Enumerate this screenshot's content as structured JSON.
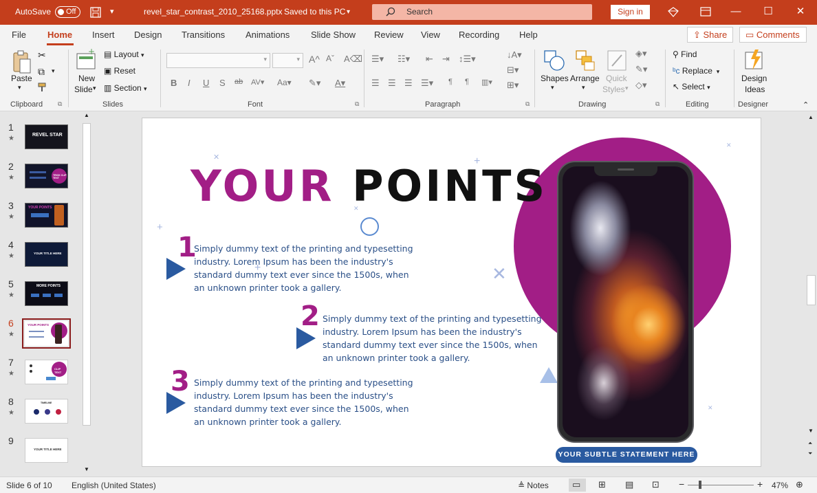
{
  "titlebar": {
    "autosave_label": "AutoSave",
    "autosave_state": "Off",
    "filename": "revel_star_contrast_2010_25168.pptx",
    "save_status": "Saved to this PC",
    "search_placeholder": "Search",
    "signin": "Sign in"
  },
  "tabs": [
    "File",
    "Home",
    "Insert",
    "Design",
    "Transitions",
    "Animations",
    "Slide Show",
    "Review",
    "View",
    "Recording",
    "Help"
  ],
  "share": "Share",
  "comments": "Comments",
  "ribbon": {
    "clipboard": {
      "paste": "Paste",
      "label": "Clipboard"
    },
    "slides": {
      "new_slide_1": "New",
      "new_slide_2": "Slide",
      "layout": "Layout",
      "reset": "Reset",
      "section": "Section",
      "label": "Slides"
    },
    "font": {
      "label": "Font"
    },
    "paragraph": {
      "label": "Paragraph"
    },
    "drawing": {
      "shapes": "Shapes",
      "arrange": "Arrange",
      "quick_styles_1": "Quick",
      "quick_styles_2": "Styles",
      "label": "Drawing"
    },
    "editing": {
      "find": "Find",
      "replace": "Replace",
      "select": "Select",
      "label": "Editing"
    },
    "designer": {
      "design_ideas_1": "Design",
      "design_ideas_2": "Ideas",
      "label": "Designer"
    }
  },
  "thumbnails": [
    {
      "num": "1",
      "caption": "REVEL STAR"
    },
    {
      "num": "2",
      "caption": "TRICK CLIP TEXT"
    },
    {
      "num": "3",
      "caption": "YOUR POINTS"
    },
    {
      "num": "4",
      "caption": "YOUR TITLE HERE"
    },
    {
      "num": "5",
      "caption": "MORE POINTS"
    },
    {
      "num": "6",
      "caption": "YOUR POINTS"
    },
    {
      "num": "7",
      "caption": "CLIP TEXT"
    },
    {
      "num": "8",
      "caption": "TIMELINE"
    },
    {
      "num": "9",
      "caption": "YOUR TITLE HERE"
    }
  ],
  "slide": {
    "title_part1": "YOUR",
    "title_part2": "POINTS",
    "points": [
      {
        "num": "1",
        "text": "Simply dummy text of the printing and typesetting industry.  Lorem Ipsum has been the industry's standard dummy text ever since the 1500s, when an unknown printer took a gallery."
      },
      {
        "num": "2",
        "text": "Simply dummy text of the printing and typesetting industry.  Lorem Ipsum has been the industry's standard dummy text ever since the 1500s, when an unknown printer took a gallery."
      },
      {
        "num": "3",
        "text": "Simply dummy text of the printing and typesetting industry.  Lorem Ipsum has been the industry's standard dummy text ever since the 1500s, when an unknown printer took a gallery."
      }
    ],
    "statement": "YOUR SUBTLE STATEMENT HERE"
  },
  "statusbar": {
    "slide_info": "Slide 6 of 10",
    "language": "English (United States)",
    "notes": "Notes",
    "zoom": "47%"
  },
  "colors": {
    "accent": "#c43e1c",
    "magenta": "#a21e86",
    "blue": "#2a5aa0"
  }
}
